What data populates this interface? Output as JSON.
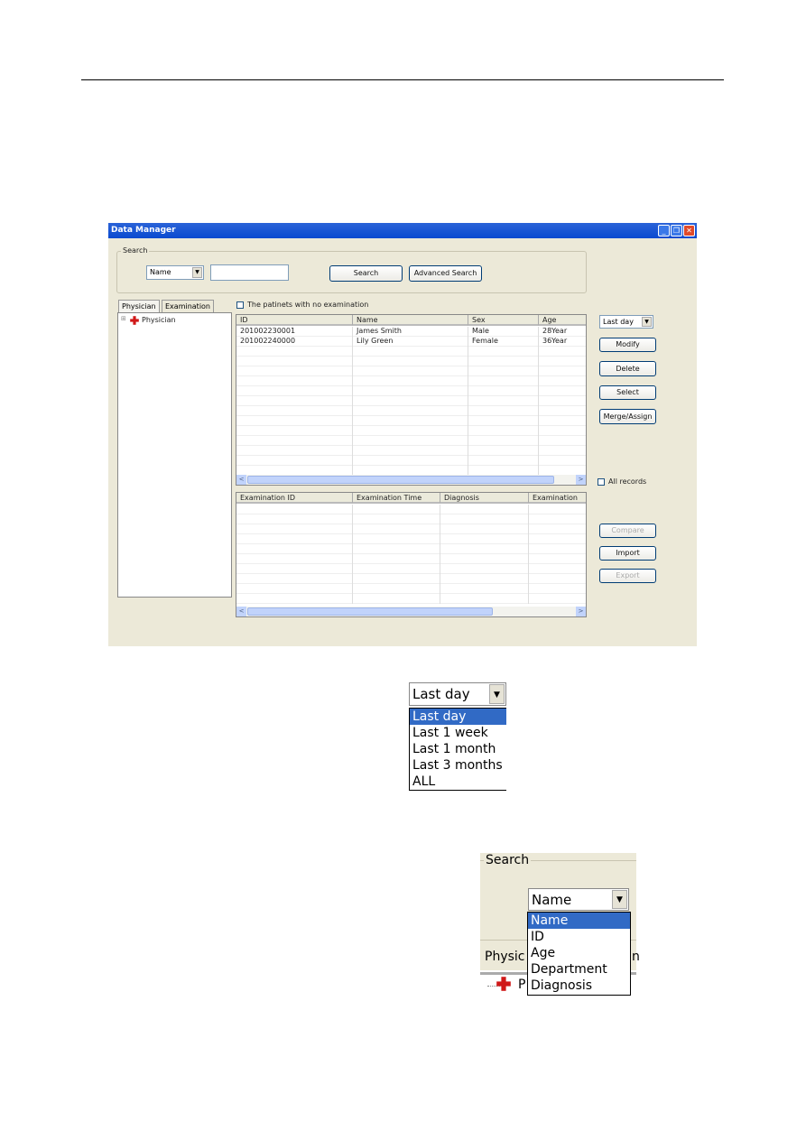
{
  "window": {
    "title": "Data Manager"
  },
  "search": {
    "group_label": "Search",
    "field_value": "Name",
    "input_value": "",
    "search_button": "Search",
    "advanced_button": "Advanced Search"
  },
  "tabs": [
    "Physician",
    "Examination"
  ],
  "tree": {
    "root": "Physician"
  },
  "no_exam_checkbox": "The patinets with no examination",
  "patients": {
    "columns": [
      "ID",
      "Name",
      "Sex",
      "Age"
    ],
    "rows": [
      [
        "201002230001",
        "James Smith",
        "Male",
        "28Year"
      ],
      [
        "201002240000",
        "Lily Green",
        "Female",
        "36Year"
      ]
    ]
  },
  "exams": {
    "columns": [
      "Examination ID",
      "Examination Time",
      "Diagnosis",
      "Examination"
    ],
    "rows": []
  },
  "right": {
    "period_value": "Last day",
    "modify": "Modify",
    "delete": "Delete",
    "select": "Select",
    "merge": "Merge/Assign",
    "all_records": "All records",
    "compare": "Compare",
    "import": "Import",
    "export": "Export"
  },
  "period_dropdown": {
    "value": "Last day",
    "options": [
      "Last day",
      "Last 1 week",
      "Last 1 month",
      "Last 3 months",
      "ALL"
    ],
    "selected": "Last day"
  },
  "field_dropdown": {
    "group_label": "Search",
    "value": "Name",
    "options": [
      "Name",
      "ID",
      "Age",
      "Department",
      "Diagnosis"
    ],
    "selected": "Name",
    "tab_fragment": "Physic",
    "tab_fragment2": "n",
    "tree_fragment": "P"
  },
  "colors": {
    "titlebar": "#0a4ad0",
    "window_bg": "#ece9d8",
    "selection": "#316ac5"
  }
}
